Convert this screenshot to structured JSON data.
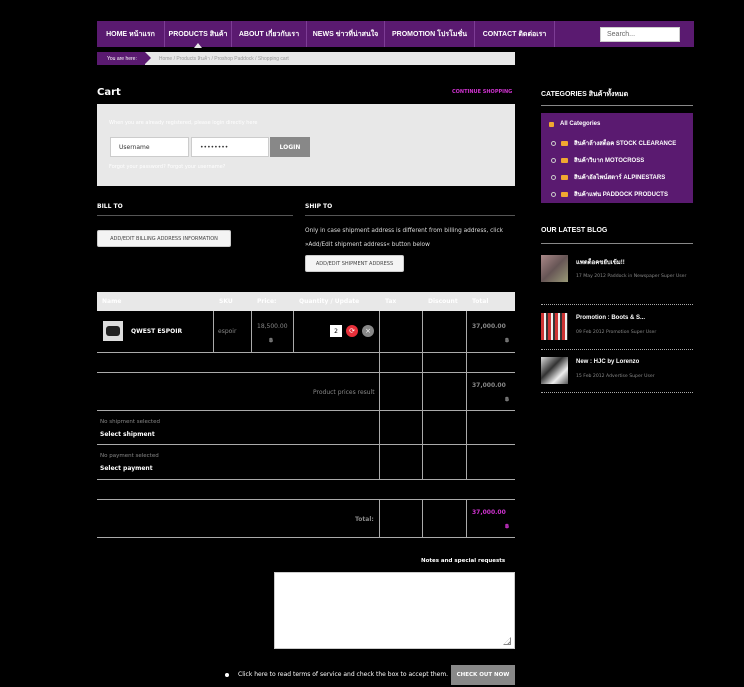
{
  "nav": {
    "items": [
      "HOME หน้าแรก",
      "PRODUCTS สินค้า",
      "ABOUT เกี่ยวกับเรา",
      "NEWS ข่าวที่น่าสนใจ",
      "PROMOTION โปรโมชั่น",
      "CONTACT ติดต่อเรา"
    ],
    "search_placeholder": "Search..."
  },
  "breadcrumb": {
    "you_are_here": "You are here:",
    "path": "Home / Products สินค้า / Proshop Paddock / Shopping cart"
  },
  "cart": {
    "title": "Cart",
    "continue": "CONTINUE SHOPPING",
    "login": {
      "hint": "When you are already registered, please login directly here",
      "username": "Username",
      "password": "••••••••",
      "button": "LOGIN",
      "remember": "Forgot your password? Forgot your username?"
    },
    "bill_to": "BILL TO",
    "ship_to": "SHIP TO",
    "ship_note": "Only in case shipment address is different from billing address, click »Add/Edit shipment address« button below",
    "bill_button": "ADD/EDIT BILLING ADDRESS INFORMATION",
    "ship_button": "ADD/EDIT SHIPMENT ADDRESS",
    "headers": {
      "name": "Name",
      "sku": "SKU",
      "price": "Price:",
      "qty": "Quantity / Update",
      "tax": "Tax",
      "discount": "Discount",
      "total": "Total"
    },
    "item": {
      "name": "QWEST ESPOIR",
      "sku": "espoir",
      "price": "18,500.00",
      "currency": "฿",
      "qty": "2",
      "total": "37,000.00"
    },
    "subtotal_label": "Product prices result",
    "subtotal": "37,000.00",
    "shipment": {
      "status": "No shipment selected",
      "action": "Select shipment"
    },
    "payment": {
      "status": "No payment selected",
      "action": "Select payment"
    },
    "total_label": "Total:",
    "grand_total": "37,000.00",
    "notes_label": "Notes and special requests",
    "terms": "Click here to read terms of service and check the box to accept them.",
    "checkout": "CHECK OUT NOW"
  },
  "sidebar": {
    "categories_title": "CATEGORIES สินค้าทั้งหมด",
    "all": "All Categories",
    "categories": [
      "สินค้าล้างสต็อค STOCK CLEARANCE",
      "สินค้าวิบาก MOTOCROSS",
      "สินค้าอัลไพน์สตาร์ ALPINESTARS",
      "สินค้าแพ่น PADDOCK PRODUCTS"
    ],
    "blog_title": "OUR LATEST BLOG",
    "posts": [
      {
        "title": "แพดด็อคขยับเข้ม!!",
        "meta": "17 May 2012  Paddock in Newspaper  Super User"
      },
      {
        "title": "Promotion : Boots & S...",
        "meta": "09 Feb 2012  Promotion  Super User"
      },
      {
        "title": "New : HJC by Lorenzo",
        "meta": "15 Feb 2012  Advertise  Super User"
      }
    ]
  },
  "colors": {
    "purple": "#5a1a70",
    "magenta": "#d033d0",
    "panel": "#e8e8e8"
  }
}
